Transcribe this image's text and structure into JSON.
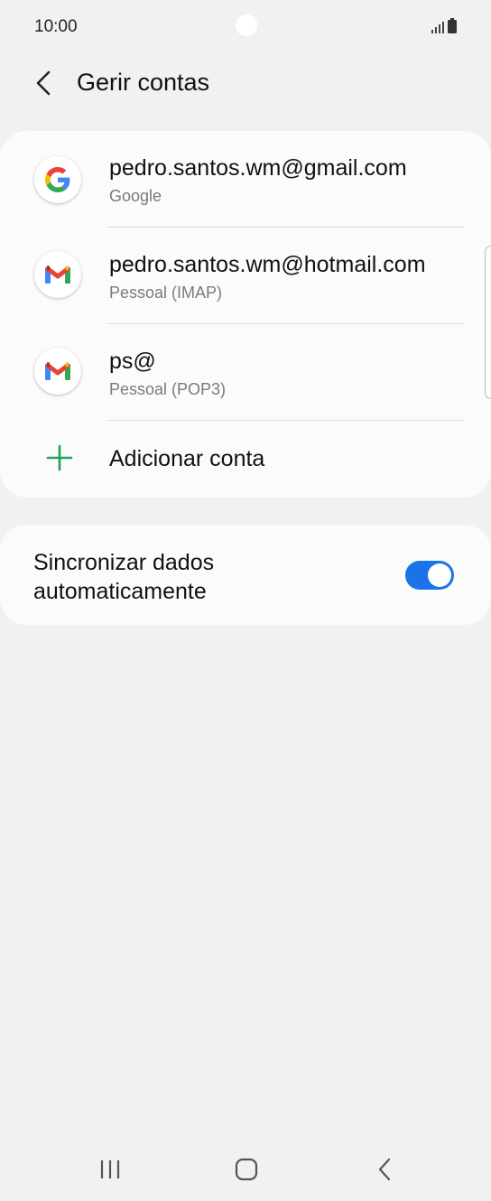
{
  "status_bar": {
    "time": "10:00",
    "icons": [
      "signal-icon",
      "battery-icon"
    ]
  },
  "header": {
    "back_icon": "chevron-left-icon",
    "title": "Gerir contas"
  },
  "accounts": [
    {
      "icon": "google-icon",
      "title": "pedro.santos.wm@gmail.com",
      "subtitle": "Google"
    },
    {
      "icon": "gmail-icon",
      "title": "pedro.santos.wm@hotmail.com",
      "subtitle": "Pessoal (IMAP)"
    },
    {
      "icon": "gmail-icon",
      "title": "ps@",
      "subtitle": "Pessoal (POP3)"
    }
  ],
  "add_account": {
    "icon": "plus-icon",
    "label": "Adicionar conta"
  },
  "sync": {
    "label": "Sincronizar dados automaticamente",
    "enabled": true
  },
  "colors": {
    "background": "#f1f1f1",
    "card": "#fbfbfb",
    "accent": "#1a73e8",
    "add_icon": "#1fa35c",
    "subtitle": "#7a7a7a"
  },
  "nav_bar": {
    "icons": [
      "recent-apps-icon",
      "home-icon",
      "back-icon"
    ]
  }
}
